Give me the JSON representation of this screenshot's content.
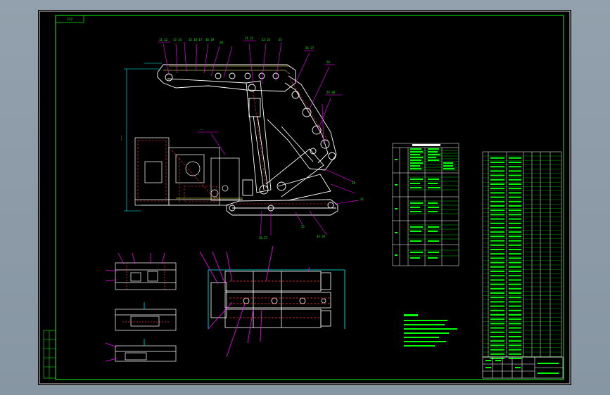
{
  "drawing": {
    "drawing_number_label": "???",
    "colors": {
      "frame": "#00ff00",
      "part_outline": "#ffffff",
      "callout": "#ff00ff",
      "hidden_line": "#ff3333",
      "dimension": "#00ffff",
      "background": "#000000",
      "viewport_background": "#8c99a6"
    }
  }
}
